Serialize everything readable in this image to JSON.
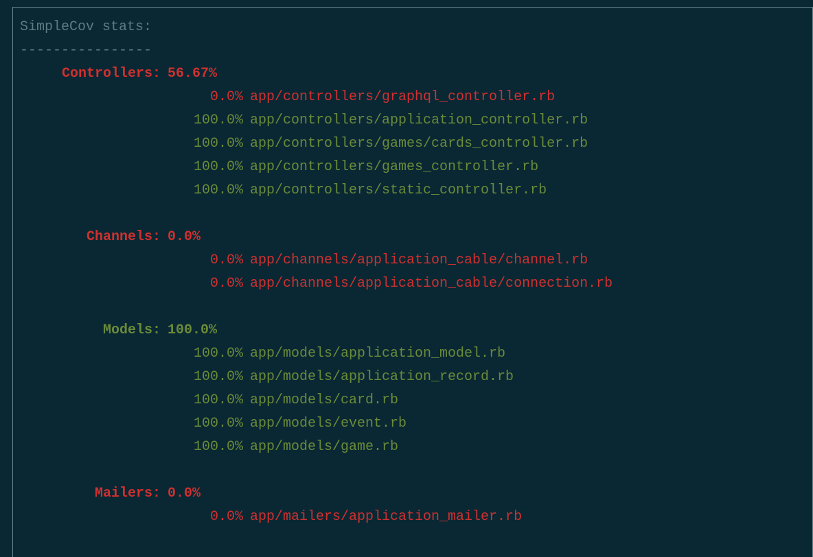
{
  "header": "SimpleCov stats:",
  "divider": "----------------",
  "groups": [
    {
      "label": "Controllers:",
      "pct": "56.67%",
      "pct_color": "red",
      "label_color": "red",
      "files": [
        {
          "pct": "0.0%",
          "path": "app/controllers/graphql_controller.rb",
          "color": "red"
        },
        {
          "pct": "100.0%",
          "path": "app/controllers/application_controller.rb",
          "color": "green"
        },
        {
          "pct": "100.0%",
          "path": "app/controllers/games/cards_controller.rb",
          "color": "green"
        },
        {
          "pct": "100.0%",
          "path": "app/controllers/games_controller.rb",
          "color": "green"
        },
        {
          "pct": "100.0%",
          "path": "app/controllers/static_controller.rb",
          "color": "green"
        }
      ]
    },
    {
      "label": "Channels:",
      "pct": "0.0%",
      "pct_color": "red",
      "label_color": "red",
      "files": [
        {
          "pct": "0.0%",
          "path": "app/channels/application_cable/channel.rb",
          "color": "red"
        },
        {
          "pct": "0.0%",
          "path": "app/channels/application_cable/connection.rb",
          "color": "red"
        }
      ]
    },
    {
      "label": "Models:",
      "pct": "100.0%",
      "pct_color": "green",
      "label_color": "green",
      "files": [
        {
          "pct": "100.0%",
          "path": "app/models/application_model.rb",
          "color": "green"
        },
        {
          "pct": "100.0%",
          "path": "app/models/application_record.rb",
          "color": "green"
        },
        {
          "pct": "100.0%",
          "path": "app/models/card.rb",
          "color": "green"
        },
        {
          "pct": "100.0%",
          "path": "app/models/event.rb",
          "color": "green"
        },
        {
          "pct": "100.0%",
          "path": "app/models/game.rb",
          "color": "green"
        }
      ]
    },
    {
      "label": "Mailers:",
      "pct": "0.0%",
      "pct_color": "red",
      "label_color": "red",
      "files": [
        {
          "pct": "0.0%",
          "path": "app/mailers/application_mailer.rb",
          "color": "red"
        }
      ]
    }
  ]
}
